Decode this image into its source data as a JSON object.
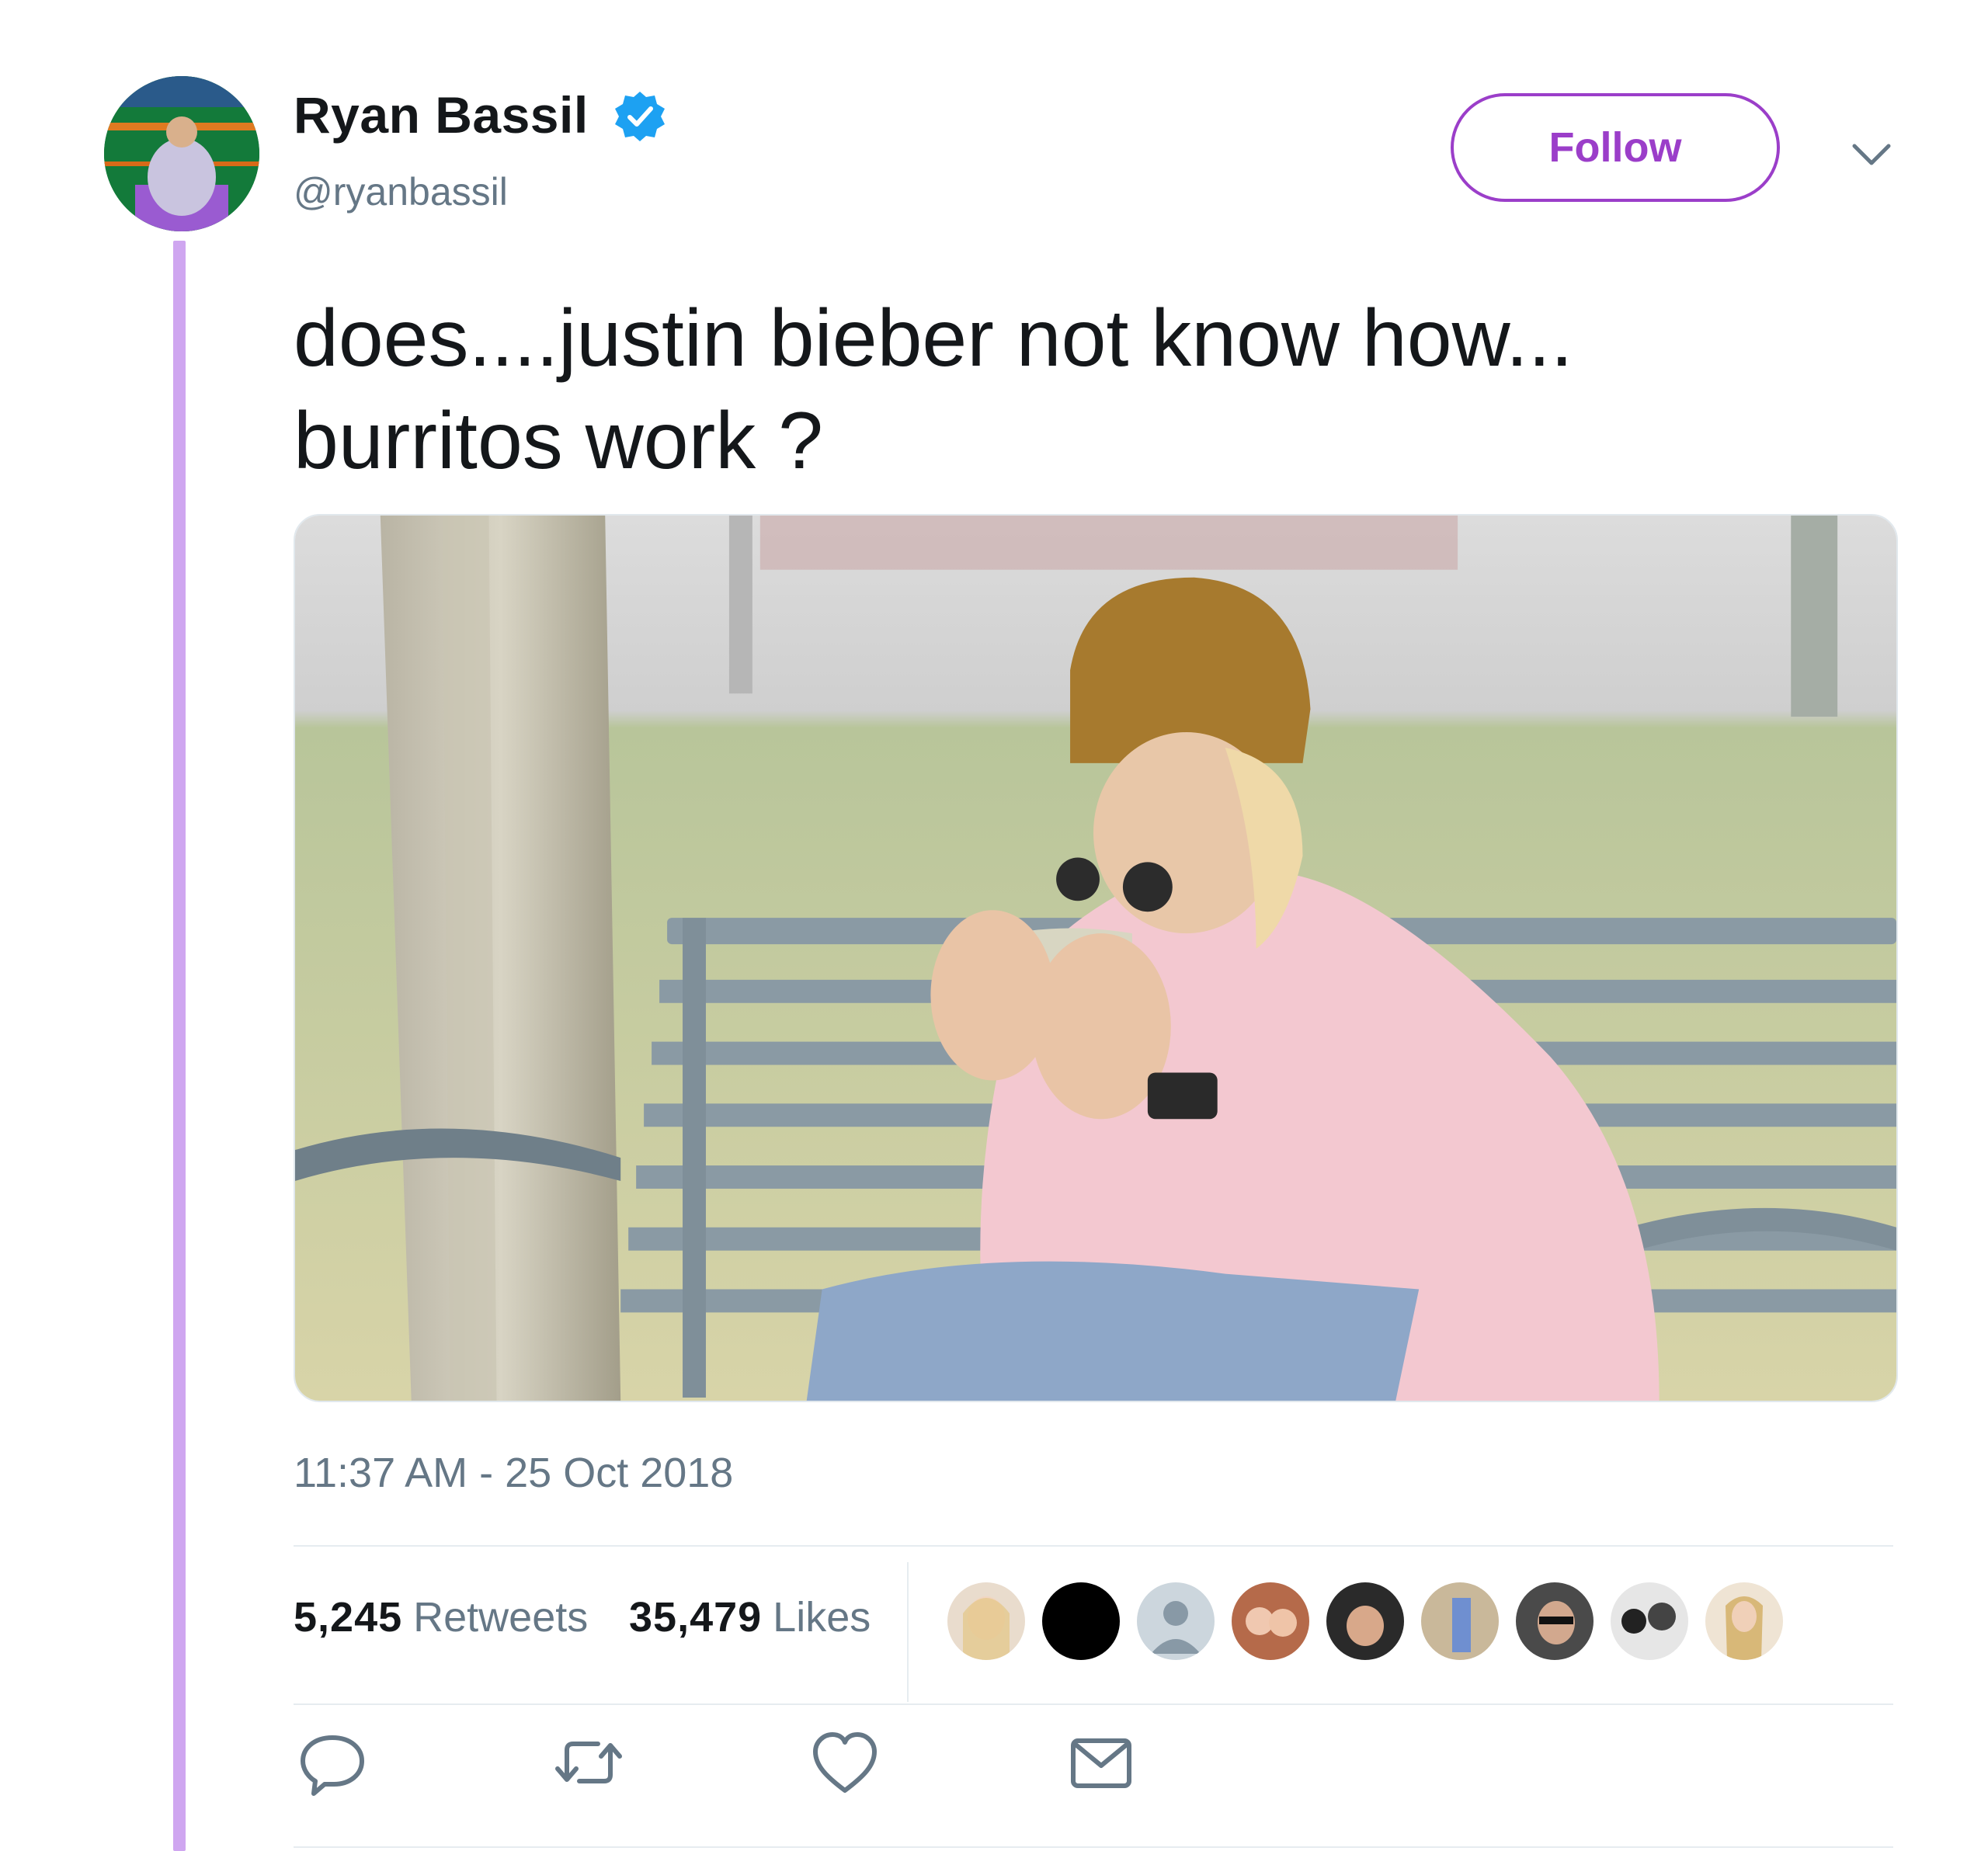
{
  "author": {
    "display_name": "Ryan Bassil",
    "handle": "@ryanbassil",
    "verified": true
  },
  "follow_button": {
    "label": "Follow"
  },
  "tweet": {
    "text_lines": [
      "does....justin bieber not know how...",
      "burritos work ?"
    ],
    "timestamp": "11:37 AM - 25 Oct 2018"
  },
  "stats": {
    "retweets_count": "5,245",
    "retweets_label": "Retweets",
    "likes_count": "35,479",
    "likes_label": "Likes"
  },
  "likers_count": 9,
  "actions": [
    "reply-icon",
    "retweet-icon",
    "like-icon",
    "message-icon"
  ],
  "colors": {
    "accent": "#9b3ec9",
    "thread_line": "#cfa6f0",
    "verified": "#1da1f2",
    "secondary_text": "#657786"
  }
}
